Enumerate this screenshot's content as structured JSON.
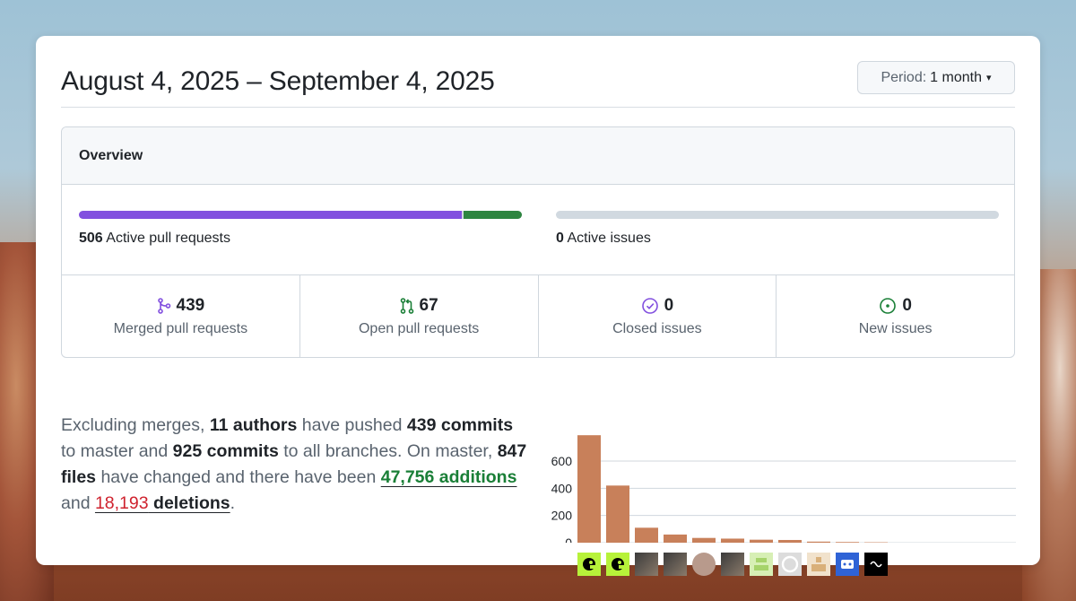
{
  "header": {
    "title": "August 4, 2025 – September 4, 2025",
    "period_label": "Period:",
    "period_value": "1 month"
  },
  "overview": {
    "heading": "Overview",
    "pull_requests": {
      "count": "506",
      "label": "Active pull requests",
      "merged_fraction": 0.8676,
      "open_fraction": 0.1324
    },
    "issues": {
      "count": "0",
      "label": "Active issues"
    },
    "stats": [
      {
        "value": "439",
        "label": "Merged pull requests",
        "icon": "merge-icon",
        "color": "#8250df"
      },
      {
        "value": "67",
        "label": "Open pull requests",
        "icon": "pull-request-icon",
        "color": "#1a7f37"
      },
      {
        "value": "0",
        "label": "Closed issues",
        "icon": "issue-closed-icon",
        "color": "#8250df"
      },
      {
        "value": "0",
        "label": "New issues",
        "icon": "issue-opened-icon",
        "color": "#1a7f37"
      }
    ]
  },
  "summary": {
    "t1": "Excluding merges, ",
    "authors": "11 authors",
    "t2": " have pushed ",
    "commits_master": "439 commits",
    "t3": " to master and ",
    "commits_all": "925 commits",
    "t4": " to all branches. On master, ",
    "files": "847 files",
    "t5": " have changed and there have been ",
    "additions": "47,756 additions",
    "t6": " and ",
    "deletions_num": "18,193",
    "deletions_word": " deletions",
    "t7": "."
  },
  "chart_data": {
    "type": "bar",
    "categories": [
      "author-1",
      "author-2",
      "author-3",
      "author-4",
      "author-5",
      "author-6",
      "author-7",
      "author-8",
      "author-9",
      "author-10",
      "author-11"
    ],
    "values": [
      790,
      420,
      110,
      60,
      35,
      30,
      22,
      20,
      8,
      5,
      3
    ],
    "yticks": [
      "0",
      "200",
      "400",
      "600"
    ],
    "ylim": [
      0,
      800
    ],
    "bar_color": "#c8805a",
    "grid": true,
    "avatars": [
      "green-alien-avatar",
      "green-alien-avatar",
      "photo-avatar",
      "photo-avatar",
      "grey-dots-avatar",
      "photo-avatar",
      "green-pattern-avatar",
      "github-octocat-avatar",
      "tan-pattern-avatar",
      "blue-bot-avatar",
      "black-logo-avatar"
    ]
  }
}
